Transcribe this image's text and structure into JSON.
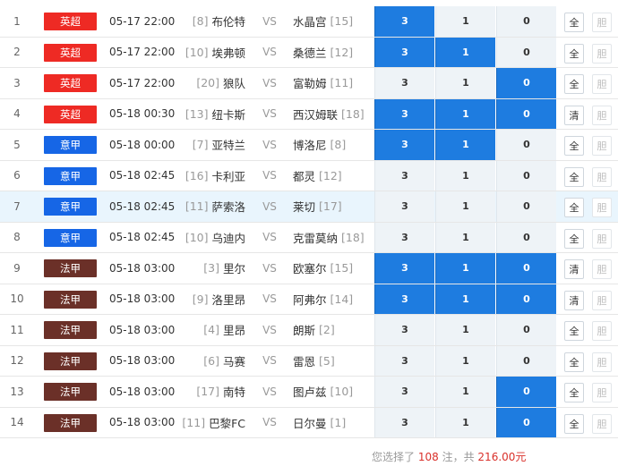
{
  "colors": {
    "epl": "#ee2a24",
    "seriea": "#1666e6",
    "ligue1": "#6b3028",
    "selected": "#1e7ce0"
  },
  "matches": [
    {
      "no": "1",
      "league": "英超",
      "league_key": "epl",
      "time": "05-17 22:00",
      "home_rank": "[8]",
      "home": "布伦特",
      "vs": "VS",
      "away": "水晶宫",
      "away_rank": "[15]",
      "o3": "3",
      "o1": "1",
      "o0": "0",
      "sel": [
        true,
        false,
        false
      ],
      "all": "全",
      "dan": "胆"
    },
    {
      "no": "2",
      "league": "英超",
      "league_key": "epl",
      "time": "05-17 22:00",
      "home_rank": "[10]",
      "home": "埃弗顿",
      "vs": "VS",
      "away": "桑德兰",
      "away_rank": "[12]",
      "o3": "3",
      "o1": "1",
      "o0": "0",
      "sel": [
        true,
        true,
        false
      ],
      "all": "全",
      "dan": "胆"
    },
    {
      "no": "3",
      "league": "英超",
      "league_key": "epl",
      "time": "05-17 22:00",
      "home_rank": "[20]",
      "home": "狼队",
      "vs": "VS",
      "away": "富勒姆",
      "away_rank": "[11]",
      "o3": "3",
      "o1": "1",
      "o0": "0",
      "sel": [
        false,
        false,
        true
      ],
      "all": "全",
      "dan": "胆"
    },
    {
      "no": "4",
      "league": "英超",
      "league_key": "epl",
      "time": "05-18 00:30",
      "home_rank": "[13]",
      "home": "纽卡斯",
      "vs": "VS",
      "away": "西汉姆联",
      "away_rank": "[18]",
      "o3": "3",
      "o1": "1",
      "o0": "0",
      "sel": [
        true,
        true,
        true
      ],
      "all": "清",
      "dan": "胆"
    },
    {
      "no": "5",
      "league": "意甲",
      "league_key": "seriea",
      "time": "05-18 00:00",
      "home_rank": "[7]",
      "home": "亚特兰",
      "vs": "VS",
      "away": "博洛尼",
      "away_rank": "[8]",
      "o3": "3",
      "o1": "1",
      "o0": "0",
      "sel": [
        true,
        true,
        false
      ],
      "all": "全",
      "dan": "胆"
    },
    {
      "no": "6",
      "league": "意甲",
      "league_key": "seriea",
      "time": "05-18 02:45",
      "home_rank": "[16]",
      "home": "卡利亚",
      "vs": "VS",
      "away": "都灵",
      "away_rank": "[12]",
      "o3": "3",
      "o1": "1",
      "o0": "0",
      "sel": [
        false,
        false,
        false
      ],
      "all": "全",
      "dan": "胆"
    },
    {
      "no": "7",
      "league": "意甲",
      "league_key": "seriea",
      "time": "05-18 02:45",
      "home_rank": "[11]",
      "home": "萨索洛",
      "vs": "VS",
      "away": "莱切",
      "away_rank": "[17]",
      "o3": "3",
      "o1": "1",
      "o0": "0",
      "sel": [
        false,
        false,
        false
      ],
      "all": "全",
      "dan": "胆",
      "hl": true
    },
    {
      "no": "8",
      "league": "意甲",
      "league_key": "seriea",
      "time": "05-18 02:45",
      "home_rank": "[10]",
      "home": "乌迪内",
      "vs": "VS",
      "away": "克雷莫纳",
      "away_rank": "[18]",
      "o3": "3",
      "o1": "1",
      "o0": "0",
      "sel": [
        false,
        false,
        false
      ],
      "all": "全",
      "dan": "胆"
    },
    {
      "no": "9",
      "league": "法甲",
      "league_key": "ligue1",
      "time": "05-18 03:00",
      "home_rank": "[3]",
      "home": "里尔",
      "vs": "VS",
      "away": "欧塞尔",
      "away_rank": "[15]",
      "o3": "3",
      "o1": "1",
      "o0": "0",
      "sel": [
        true,
        true,
        true
      ],
      "all": "清",
      "dan": "胆"
    },
    {
      "no": "10",
      "league": "法甲",
      "league_key": "ligue1",
      "time": "05-18 03:00",
      "home_rank": "[9]",
      "home": "洛里昂",
      "vs": "VS",
      "away": "阿弗尔",
      "away_rank": "[14]",
      "o3": "3",
      "o1": "1",
      "o0": "0",
      "sel": [
        true,
        true,
        true
      ],
      "all": "清",
      "dan": "胆"
    },
    {
      "no": "11",
      "league": "法甲",
      "league_key": "ligue1",
      "time": "05-18 03:00",
      "home_rank": "[4]",
      "home": "里昂",
      "vs": "VS",
      "away": "朗斯",
      "away_rank": "[2]",
      "o3": "3",
      "o1": "1",
      "o0": "0",
      "sel": [
        false,
        false,
        false
      ],
      "all": "全",
      "dan": "胆"
    },
    {
      "no": "12",
      "league": "法甲",
      "league_key": "ligue1",
      "time": "05-18 03:00",
      "home_rank": "[6]",
      "home": "马赛",
      "vs": "VS",
      "away": "雷恩",
      "away_rank": "[5]",
      "o3": "3",
      "o1": "1",
      "o0": "0",
      "sel": [
        false,
        false,
        false
      ],
      "all": "全",
      "dan": "胆"
    },
    {
      "no": "13",
      "league": "法甲",
      "league_key": "ligue1",
      "time": "05-18 03:00",
      "home_rank": "[17]",
      "home": "南特",
      "vs": "VS",
      "away": "图卢兹",
      "away_rank": "[10]",
      "o3": "3",
      "o1": "1",
      "o0": "0",
      "sel": [
        false,
        false,
        true
      ],
      "all": "全",
      "dan": "胆"
    },
    {
      "no": "14",
      "league": "法甲",
      "league_key": "ligue1",
      "time": "05-18 03:00",
      "home_rank": "[11]",
      "home": "巴黎FC",
      "vs": "VS",
      "away": "日尔曼",
      "away_rank": "[1]",
      "o3": "3",
      "o1": "1",
      "o0": "0",
      "sel": [
        false,
        false,
        true
      ],
      "all": "全",
      "dan": "胆"
    }
  ],
  "footer": {
    "prefix": "您选择了",
    "count": "108",
    "mid": "注，共",
    "amount": "216.00",
    "suffix": "元"
  }
}
